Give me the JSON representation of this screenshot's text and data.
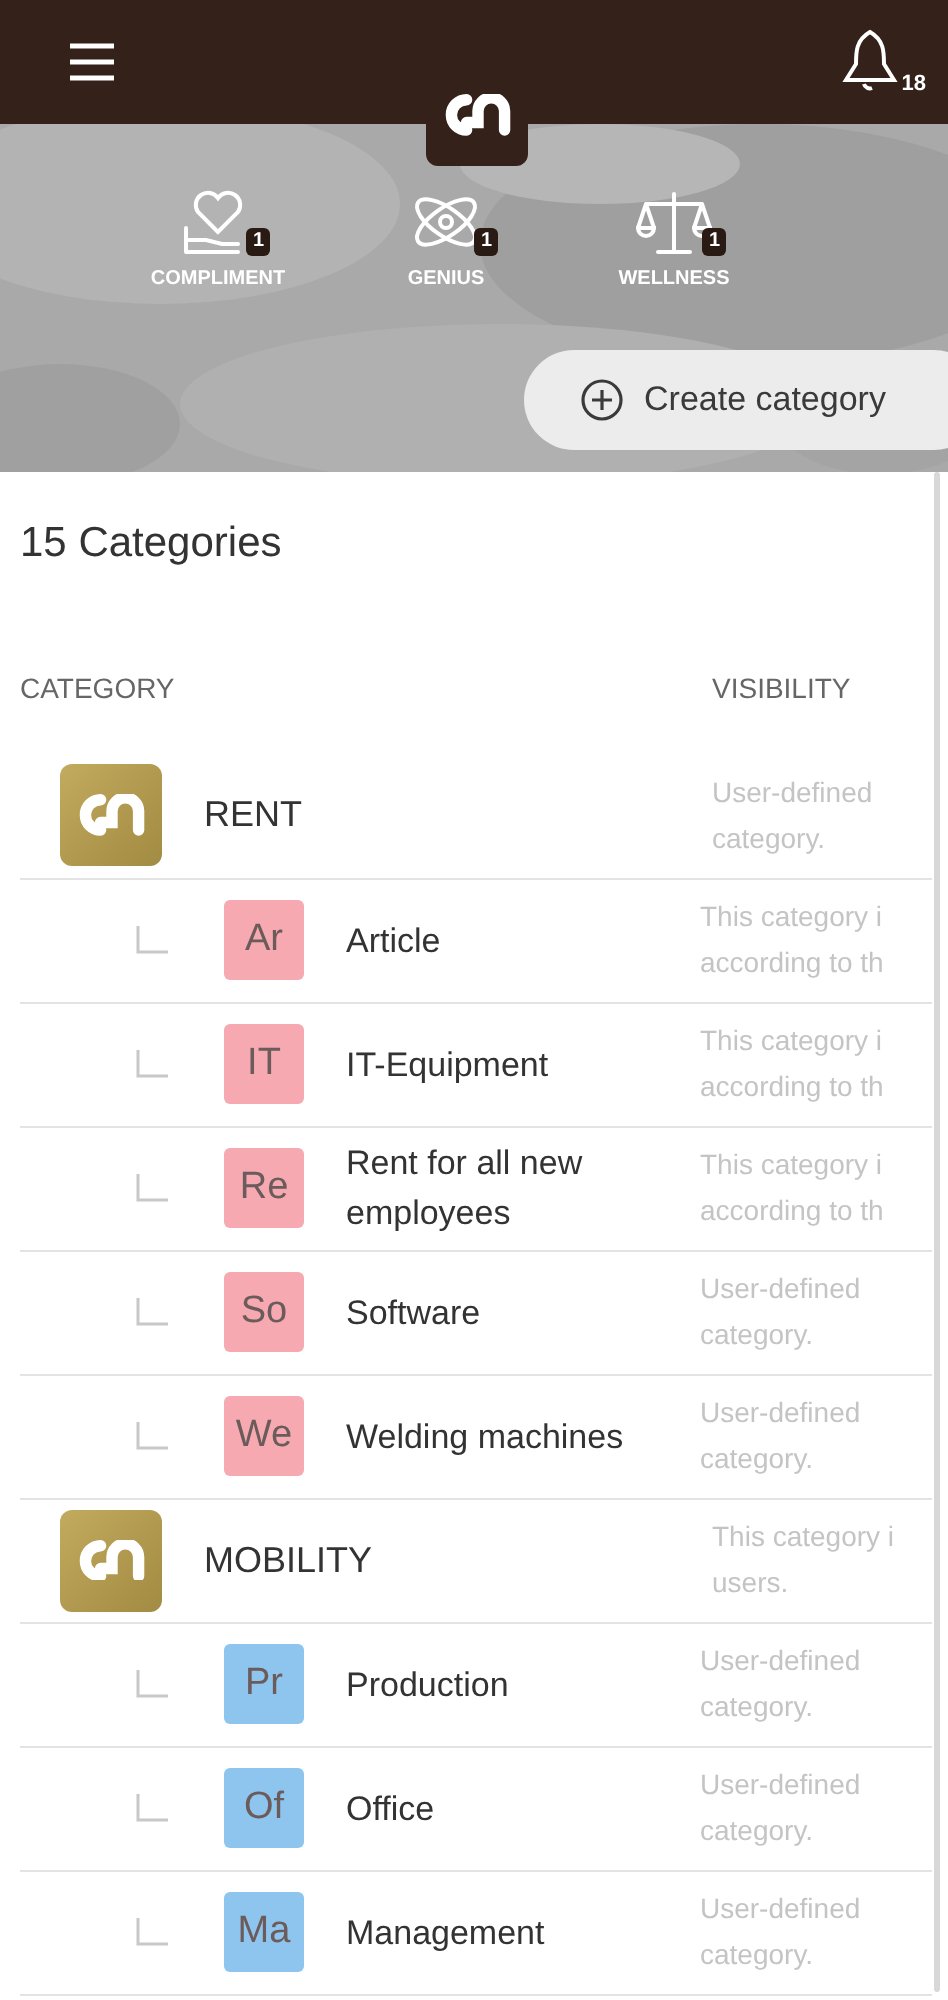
{
  "header": {
    "notification_count": "18"
  },
  "awards": [
    {
      "kind": "heart-hand",
      "label": "COMPLIMENT",
      "count": "1"
    },
    {
      "kind": "atom",
      "label": "GENIUS",
      "count": "1"
    },
    {
      "kind": "scale",
      "label": "WELLNESS",
      "count": "1"
    }
  ],
  "create_button": {
    "label": "Create category"
  },
  "title": "15 Categories",
  "columns": [
    "CATEGORY",
    "VISIBILITY"
  ],
  "categories": [
    {
      "name": "RENT",
      "visibility": [
        "User-defined",
        "category."
      ],
      "children": [
        {
          "abbr": "Ar",
          "name": "Article",
          "color": "#f6a9b1",
          "visibility": [
            "This category i",
            "according to th"
          ]
        },
        {
          "abbr": "IT",
          "name": "IT-Equipment",
          "color": "#f6a9b1",
          "visibility": [
            "This category i",
            "according to th"
          ]
        },
        {
          "abbr": "Re",
          "name": "Rent for all new employees",
          "color": "#f6a9b1",
          "visibility": [
            "This category i",
            "according to th"
          ]
        },
        {
          "abbr": "So",
          "name": "Software",
          "color": "#f6a9b1",
          "visibility": [
            "User-defined",
            "category."
          ]
        },
        {
          "abbr": "We",
          "name": "Welding machines",
          "color": "#f6a9b1",
          "visibility": [
            "User-defined",
            "category."
          ]
        }
      ]
    },
    {
      "name": "MOBILITY",
      "visibility": [
        "This category i",
        "users."
      ],
      "children": [
        {
          "abbr": "Pr",
          "name": "Production",
          "color": "#8ec5ef",
          "visibility": [
            "User-defined",
            "category."
          ]
        },
        {
          "abbr": "Of",
          "name": "Office",
          "color": "#8ec5ef",
          "visibility": [
            "User-defined",
            "category."
          ]
        },
        {
          "abbr": "Ma",
          "name": "Management",
          "color": "#8ec5ef",
          "visibility": [
            "User-defined",
            "category."
          ]
        }
      ]
    }
  ]
}
